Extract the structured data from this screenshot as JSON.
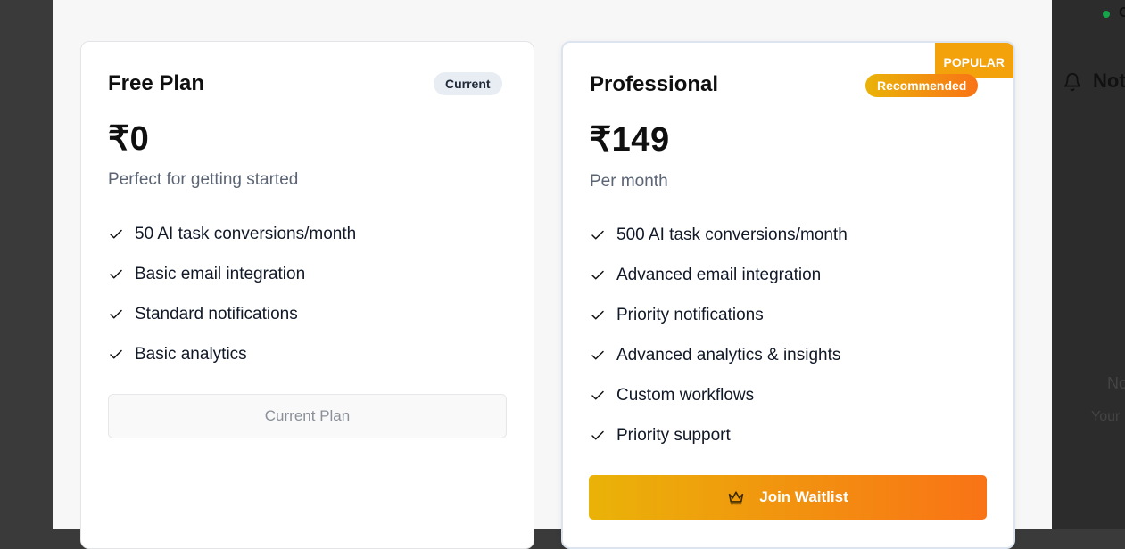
{
  "background": {
    "status_text": "O",
    "heading": "Not",
    "empty_title": "No",
    "empty_sub": "Your"
  },
  "free_plan": {
    "name": "Free Plan",
    "badge": "Current",
    "price": "₹0",
    "description": "Perfect for getting started",
    "features": [
      "50 AI task conversions/month",
      "Basic email integration",
      "Standard notifications",
      "Basic analytics"
    ],
    "button_label": "Current Plan"
  },
  "pro_plan": {
    "ribbon": "POPULAR",
    "name": "Professional",
    "badge": "Recommended",
    "price": "₹149",
    "description": "Per month",
    "features": [
      "500 AI task conversions/month",
      "Advanced email integration",
      "Priority notifications",
      "Advanced analytics & insights",
      "Custom workflows",
      "Priority support"
    ],
    "button_label": "Join Waitlist",
    "button_icon": "crown-icon"
  },
  "colors": {
    "accent_start": "#eab308",
    "accent_end": "#f97316",
    "popular_ribbon": "#f4a20c"
  }
}
